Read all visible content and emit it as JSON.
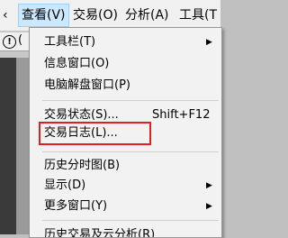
{
  "menubar": {
    "items": [
      {
        "label": "‹"
      },
      {
        "label": "查看(V)"
      },
      {
        "label": "交易(O)"
      },
      {
        "label": "分析(A)"
      },
      {
        "label": "工具(T"
      }
    ]
  },
  "toolbar": {
    "icon_glyph": "!",
    "trailing_glyph": "("
  },
  "dropdown": {
    "items": [
      {
        "label": "工具栏(T)",
        "submenu": true
      },
      {
        "label": "信息窗口(O)"
      },
      {
        "label": "电脑解盘窗口(P)"
      },
      {
        "label": "交易状态(S)...",
        "shortcut": "Shift+F12"
      },
      {
        "label": "交易日志(L)...",
        "highlighted": true
      },
      {
        "label": "历史分时图(B)"
      },
      {
        "label": "显示(D)",
        "submenu": true
      },
      {
        "label": "更多窗口(Y)",
        "submenu": true
      },
      {
        "label": "历史交易及云分析(R)"
      }
    ],
    "arrow_glyph": "▶"
  },
  "colors": {
    "highlight_border": "#e02020",
    "active_menu_bg": "#cce8ff"
  }
}
